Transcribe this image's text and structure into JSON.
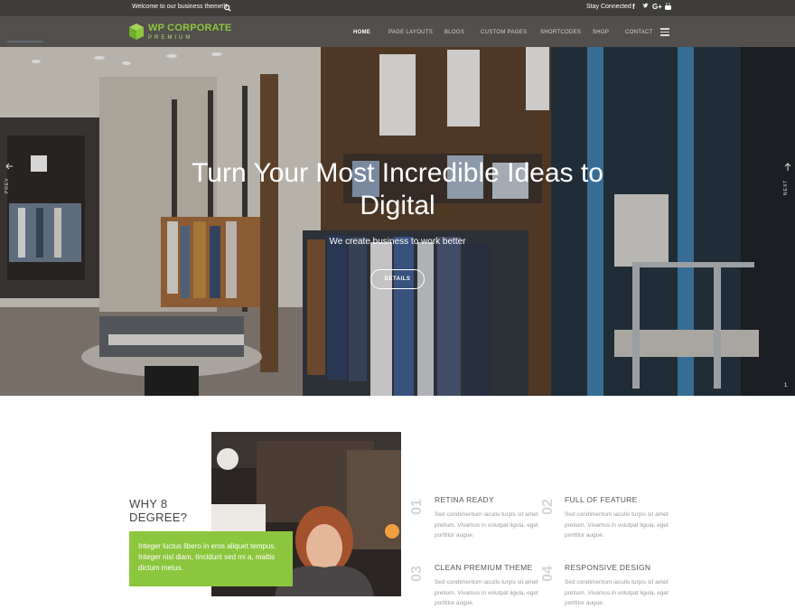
{
  "topbar": {
    "welcome": "Welcome to our business theme!!!",
    "stay_connected": "Stay Connected",
    "social": [
      "f",
      "t",
      "G+",
      "yt"
    ]
  },
  "logo": {
    "title": "WP CORPORATE",
    "subtitle": "PREMIUM"
  },
  "nav": {
    "items": [
      "HOME",
      "PAGE LAYOUTS",
      "BLOGS",
      "CUSTOM PAGES",
      "SHORTCODES",
      "SHOP",
      "CONTACT"
    ],
    "active": "HOME"
  },
  "hero": {
    "title": "Turn Your Most Incredible Ideas to Digital",
    "subtitle": "We create business to work better",
    "button": "DETAILS",
    "prev": "PREV",
    "next": "NEXT",
    "slide_number": "1"
  },
  "about": {
    "title": "WHY 8 DEGREE?",
    "text": "Integer luctus libero in eros aliquet tempus. Integer nisl diam, tincidunt sed mi a, mattis dictum metus."
  },
  "features": [
    {
      "num": "01",
      "title": "RETINA READY",
      "text": "Sed condimentum iaculis turpis sit amet pretium. Vivamus in volutpat ligula, eget porttitor augue."
    },
    {
      "num": "02",
      "title": "FULL OF FEATURE",
      "text": "Sed condimentum iaculis turpis sit amet pretium. Vivamus in volutpat ligula, eget porttitor augue."
    },
    {
      "num": "03",
      "title": "CLEAN PREMIUM THEME",
      "text": "Sed condimentum iaculis turpis sit amet pretium. Vivamus in volutpat ligula, eget porttitor augue."
    },
    {
      "num": "04",
      "title": "RESPONSIVE DESIGN",
      "text": "Sed condimentum iaculis turpis sit amet pretium. Vivamus in volutpat ligula, eget porttitor augue."
    }
  ],
  "colors": {
    "accent": "#8cc63e",
    "topbar": "#3a3a3a",
    "text": "#444444"
  }
}
